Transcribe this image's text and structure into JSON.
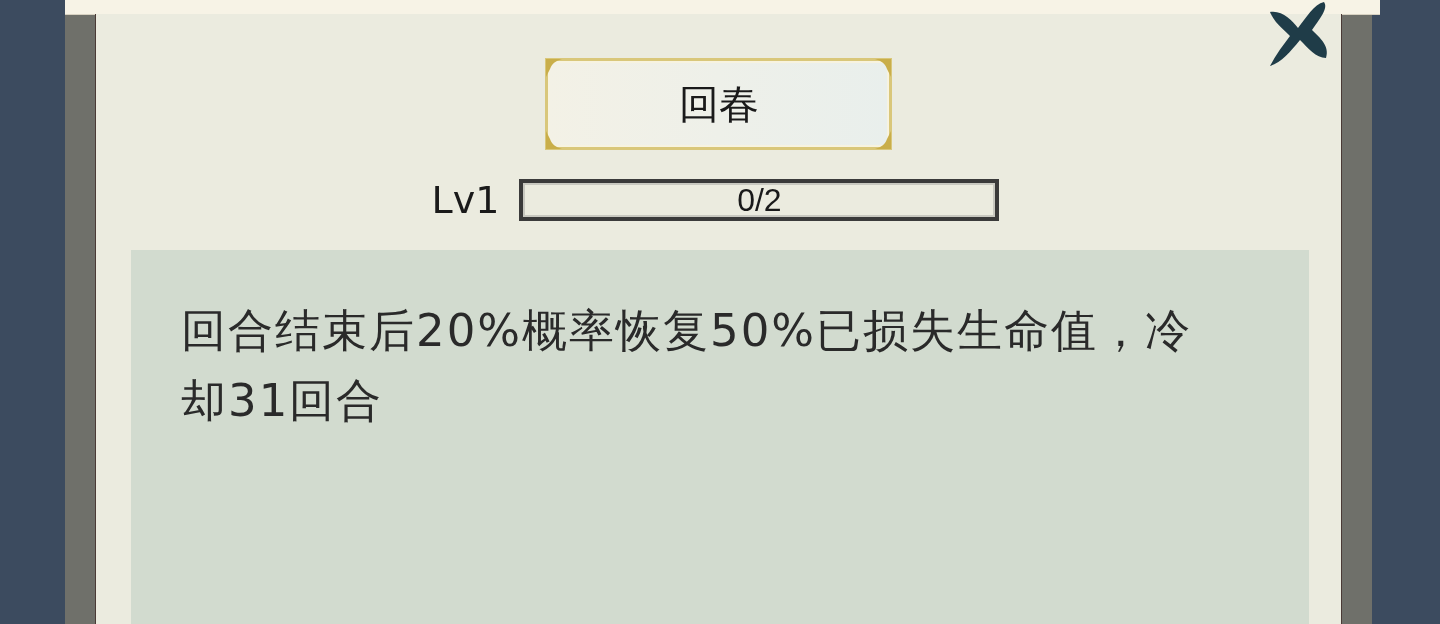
{
  "skill": {
    "name": "回春",
    "level_label": "Lv1",
    "progress": {
      "level": 0,
      "reading": "0/2"
    },
    "description": "回合结束后20%概率恢复50%已损失生命值，冷却31回合"
  }
}
